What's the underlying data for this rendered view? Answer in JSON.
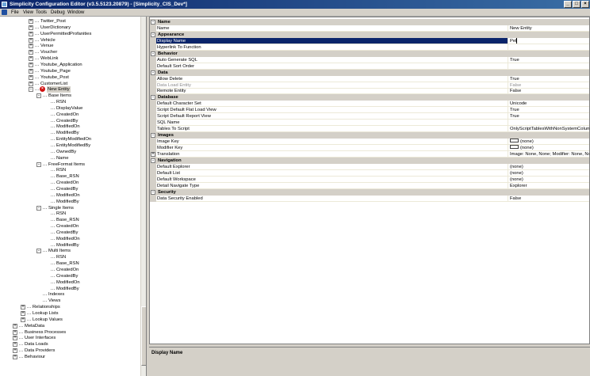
{
  "window": {
    "title": "Simplicity Configuration Editor (v3.5.5123.20879) - [Simplicity_CIS_Dev*]",
    "minimize": "_",
    "restore": "□",
    "close": "×"
  },
  "menu": {
    "items": [
      "File",
      "View",
      "Tools",
      "Debug",
      "Window"
    ]
  },
  "tree": {
    "nodes": [
      {
        "label": "Twitter_Post",
        "depth": 2,
        "expander": "+"
      },
      {
        "label": "UserDictionary",
        "depth": 2,
        "expander": "+"
      },
      {
        "label": "UserPermittedProfanities",
        "depth": 2,
        "expander": "+"
      },
      {
        "label": "Vehicle",
        "depth": 2,
        "expander": "+"
      },
      {
        "label": "Venue",
        "depth": 2,
        "expander": "+"
      },
      {
        "label": "Voucher",
        "depth": 2,
        "expander": "+"
      },
      {
        "label": "WebLink",
        "depth": 2,
        "expander": "+"
      },
      {
        "label": "Youtube_Application",
        "depth": 2,
        "expander": "+"
      },
      {
        "label": "Youtube_Page",
        "depth": 2,
        "expander": "+"
      },
      {
        "label": "Youtube_Post",
        "depth": 2,
        "expander": "+"
      },
      {
        "label": "CustomerList",
        "depth": 2,
        "expander": "+"
      },
      {
        "label": "New Entity",
        "depth": 2,
        "expander": "-",
        "error": true,
        "selected": true
      },
      {
        "label": "Base Items",
        "depth": 3,
        "expander": "-"
      },
      {
        "label": "RSN",
        "depth": 4
      },
      {
        "label": "DisplayValue",
        "depth": 4
      },
      {
        "label": "CreatedOn",
        "depth": 4
      },
      {
        "label": "CreatedBy",
        "depth": 4
      },
      {
        "label": "ModifiedOn",
        "depth": 4
      },
      {
        "label": "ModifiedBy",
        "depth": 4
      },
      {
        "label": "EntityModifiedOn",
        "depth": 4
      },
      {
        "label": "EntityModifiedBy",
        "depth": 4
      },
      {
        "label": "OwnedBy",
        "depth": 4
      },
      {
        "label": "Name",
        "depth": 4
      },
      {
        "label": "FreeFormat Items",
        "depth": 3,
        "expander": "-"
      },
      {
        "label": "RSN",
        "depth": 4
      },
      {
        "label": "Base_RSN",
        "depth": 4
      },
      {
        "label": "CreatedOn",
        "depth": 4
      },
      {
        "label": "CreatedBy",
        "depth": 4
      },
      {
        "label": "ModifiedOn",
        "depth": 4
      },
      {
        "label": "ModifiedBy",
        "depth": 4
      },
      {
        "label": "Single Items",
        "depth": 3,
        "expander": "-"
      },
      {
        "label": "RSN",
        "depth": 4
      },
      {
        "label": "Base_RSN",
        "depth": 4
      },
      {
        "label": "CreatedOn",
        "depth": 4
      },
      {
        "label": "CreatedBy",
        "depth": 4
      },
      {
        "label": "ModifiedOn",
        "depth": 4
      },
      {
        "label": "ModifiedBy",
        "depth": 4
      },
      {
        "label": "Multi Items",
        "depth": 3,
        "expander": "-"
      },
      {
        "label": "RSN",
        "depth": 4
      },
      {
        "label": "Base_RSN",
        "depth": 4
      },
      {
        "label": "CreatedOn",
        "depth": 4
      },
      {
        "label": "CreatedBy",
        "depth": 4
      },
      {
        "label": "ModifiedOn",
        "depth": 4
      },
      {
        "label": "ModifiedBy",
        "depth": 4
      },
      {
        "label": "Indexes",
        "depth": 3
      },
      {
        "label": "Views",
        "depth": 3
      },
      {
        "label": "Relationships",
        "depth": 1,
        "expander": "+"
      },
      {
        "label": "Lookup Lists",
        "depth": 1,
        "expander": "+"
      },
      {
        "label": "Lookup Values",
        "depth": 1,
        "expander": "+"
      },
      {
        "label": "MetaData",
        "depth": 0,
        "expander": "+"
      },
      {
        "label": "Business Processes",
        "depth": 0,
        "expander": "+"
      },
      {
        "label": "User Interfaces",
        "depth": 0,
        "expander": "+"
      },
      {
        "label": "Data Loads",
        "depth": 0,
        "expander": "+"
      },
      {
        "label": "Data Providers",
        "depth": 0,
        "expander": "+"
      },
      {
        "label": "Behaviour",
        "depth": 0,
        "expander": "+"
      }
    ]
  },
  "properties": {
    "rows": [
      {
        "type": "category",
        "label": "Name",
        "toggle": "-"
      },
      {
        "type": "prop",
        "name": "Name",
        "value": "New Entity"
      },
      {
        "type": "category",
        "label": "Appearance",
        "toggle": "-"
      },
      {
        "type": "prop",
        "name": "Display Name",
        "value": "Pel",
        "selected": true,
        "editing": true
      },
      {
        "type": "prop",
        "name": "Hyperlink To Function",
        "value": ""
      },
      {
        "type": "category",
        "label": "Behavior",
        "toggle": "-"
      },
      {
        "type": "prop",
        "name": "Auto Generate SQL",
        "value": "True"
      },
      {
        "type": "prop",
        "name": "Default Sort Order",
        "value": ""
      },
      {
        "type": "category",
        "label": "Data",
        "toggle": "-"
      },
      {
        "type": "prop",
        "name": "Allow Delete",
        "value": "True"
      },
      {
        "type": "prop",
        "name": "Data Load Entity",
        "value": "False",
        "disabled": true
      },
      {
        "type": "prop",
        "name": "Remote Entity",
        "value": "False"
      },
      {
        "type": "category",
        "label": "Database",
        "toggle": "-"
      },
      {
        "type": "prop",
        "name": "Default Character Set",
        "value": "Unicode"
      },
      {
        "type": "prop",
        "name": "Script Default Flat Load View",
        "value": "True"
      },
      {
        "type": "prop",
        "name": "Script Default Report View",
        "value": "True"
      },
      {
        "type": "prop",
        "name": "SQL Name",
        "value": ""
      },
      {
        "type": "prop",
        "name": "Tables To Script",
        "value": "OnlyScriptTablesWithNonSystemColumns"
      },
      {
        "type": "category",
        "label": "Images",
        "toggle": "-"
      },
      {
        "type": "prop",
        "name": "Image Key",
        "value": "(none)",
        "swatch": true
      },
      {
        "type": "prop",
        "name": "Modifier Key",
        "value": "(none)",
        "swatch": true
      },
      {
        "type": "prop",
        "name": "Translation",
        "value": "Image: None, None; Modifier: None, None",
        "expander": "+"
      },
      {
        "type": "category",
        "label": "Navigation",
        "toggle": "-"
      },
      {
        "type": "prop",
        "name": "Default Explorer",
        "value": "(none)"
      },
      {
        "type": "prop",
        "name": "Default List",
        "value": "(none)"
      },
      {
        "type": "prop",
        "name": "Default Workspace",
        "value": "(none)"
      },
      {
        "type": "prop",
        "name": "Detail Navigate Type",
        "value": "Explorer"
      },
      {
        "type": "category",
        "label": "Security",
        "toggle": "-"
      },
      {
        "type": "prop",
        "name": "Data Security Enabled",
        "value": "False"
      }
    ]
  },
  "description": {
    "title": "Display Name"
  }
}
